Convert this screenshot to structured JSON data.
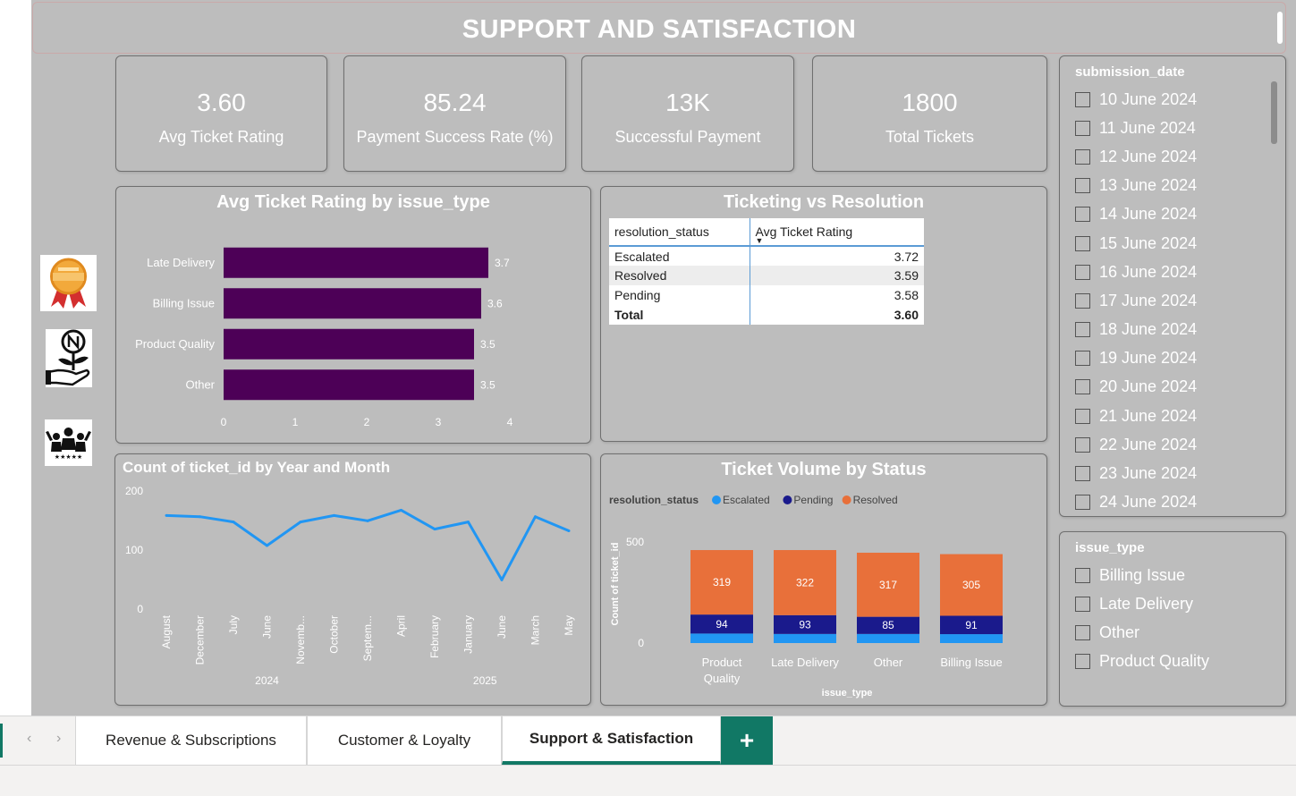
{
  "page_title": "SUPPORT AND SATISFACTION",
  "kpis": [
    {
      "value": "3.60",
      "label": "Avg Ticket Rating"
    },
    {
      "value": "85.24",
      "label": "Payment Success Rate (%)"
    },
    {
      "value": "13K",
      "label": "Successful Payment"
    },
    {
      "value": "1800",
      "label": "Total Tickets"
    }
  ],
  "side_icons": [
    "loyalty-program-icon",
    "money-hand-icon",
    "community-icon"
  ],
  "bar_chart": {
    "title": "Avg Ticket Rating by issue_type",
    "chart_data": {
      "type": "bar",
      "orientation": "horizontal",
      "categories": [
        "Late Delivery",
        "Billing Issue",
        "Product Quality",
        "Other"
      ],
      "values": [
        3.7,
        3.6,
        3.5,
        3.5
      ],
      "xlim": [
        0,
        4
      ],
      "xticks": [
        "0",
        "1",
        "2",
        "3",
        "4"
      ],
      "color": "#4d0057"
    }
  },
  "table": {
    "title": "Ticketing vs Resolution",
    "headers": [
      "resolution_status",
      "Avg Ticket Rating"
    ],
    "rows": [
      [
        "Escalated",
        "3.72"
      ],
      [
        "Resolved",
        "3.59"
      ],
      [
        "Pending",
        "3.58"
      ]
    ],
    "total": [
      "Total",
      "3.60"
    ]
  },
  "line_chart": {
    "title": "Count of ticket_id by Year and Month",
    "chart_data": {
      "type": "line",
      "x": [
        "August",
        "December",
        "July",
        "June",
        "Novemb...",
        "October",
        "Septem...",
        "April",
        "February",
        "January",
        "June",
        "March",
        "May"
      ],
      "years": [
        {
          "label": "2024",
          "count": 7
        },
        {
          "label": "2025",
          "count": 6
        }
      ],
      "values": [
        157,
        155,
        146,
        106,
        146,
        157,
        148,
        166,
        134,
        146,
        48,
        155,
        131
      ],
      "ylim": [
        0,
        200
      ],
      "yticks": [
        "0",
        "100",
        "200"
      ],
      "color": "#2196f3"
    }
  },
  "stacked_chart": {
    "title": "Ticket Volume by Status",
    "legend_title": "resolution_status",
    "legend": [
      {
        "name": "Escalated",
        "color": "#2196f3"
      },
      {
        "name": "Pending",
        "color": "#1a1a8c"
      },
      {
        "name": "Resolved",
        "color": "#e8703a"
      }
    ],
    "xlabel": "issue_type",
    "ylabel": "Count of ticket_id",
    "chart_data": {
      "type": "bar",
      "stacked": true,
      "categories": [
        "Product Quality",
        "Late Delivery",
        "Other",
        "Billing Issue"
      ],
      "category_lines": [
        [
          "Product",
          "Quality"
        ],
        [
          "Late Delivery"
        ],
        [
          "Other"
        ],
        [
          "Billing Issue"
        ]
      ],
      "series": [
        {
          "name": "Escalated",
          "values": [
            47,
            45,
            45,
            44
          ]
        },
        {
          "name": "Pending",
          "values": [
            94,
            93,
            85,
            91
          ]
        },
        {
          "name": "Resolved",
          "values": [
            319,
            322,
            317,
            305
          ]
        }
      ],
      "ylim": [
        0,
        500
      ],
      "yticks": [
        "0",
        "500"
      ]
    }
  },
  "date_slicer": {
    "title": "submission_date",
    "items": [
      "10 June 2024",
      "11 June 2024",
      "12 June 2024",
      "13 June 2024",
      "14 June 2024",
      "15 June 2024",
      "16 June 2024",
      "17 June 2024",
      "18 June 2024",
      "19 June 2024",
      "20 June 2024",
      "21 June 2024",
      "22 June 2024",
      "23 June 2024",
      "24 June 2024"
    ]
  },
  "issue_slicer": {
    "title": "issue_type",
    "items": [
      "Billing Issue",
      "Late Delivery",
      "Other",
      "Product Quality"
    ]
  },
  "tabs": [
    {
      "label": "Revenue & Subscriptions",
      "active": false
    },
    {
      "label": "Customer & Loyalty",
      "active": false
    },
    {
      "label": "Support & Satisfaction",
      "active": true
    }
  ],
  "add_tab_label": "+",
  "nav": {
    "prev": "‹",
    "next": "›"
  }
}
